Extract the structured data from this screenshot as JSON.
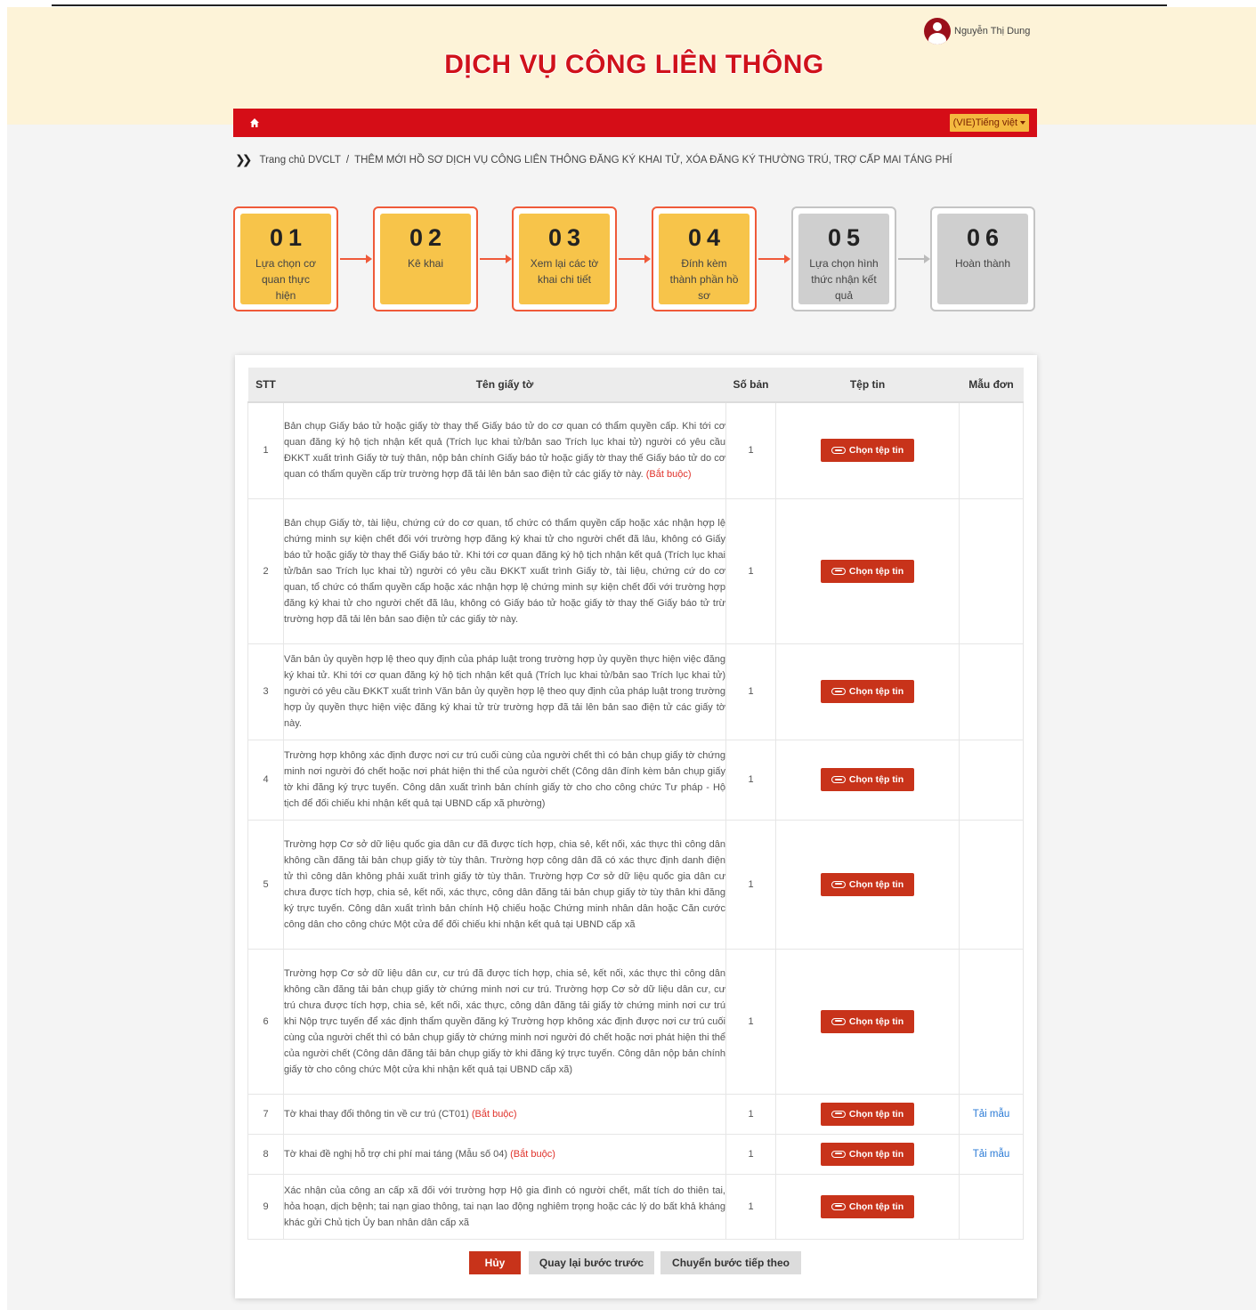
{
  "header": {
    "title": "DỊCH VỤ CÔNG LIÊN THÔNG",
    "user_name": "Nguyễn Thị Dung",
    "language": "(VIE)Tiếng việt"
  },
  "breadcrumb": {
    "home": "Trang chủ DVCLT",
    "separator": "/",
    "current": "THÊM MỚI HỒ SƠ DỊCH VỤ CÔNG LIÊN THÔNG ĐĂNG KÝ KHAI TỬ, XÓA ĐĂNG KÝ THƯỜNG TRÚ, TRỢ CẤP MAI TÁNG PHÍ"
  },
  "steps": [
    {
      "number": "01",
      "label": "Lựa chọn cơ quan thực hiện",
      "state": "done"
    },
    {
      "number": "02",
      "label": "Kê khai",
      "state": "done"
    },
    {
      "number": "03",
      "label": "Xem lại các tờ khai chi tiết",
      "state": "done"
    },
    {
      "number": "04",
      "label": "Đính kèm thành phần hồ sơ",
      "state": "current"
    },
    {
      "number": "05",
      "label": "Lựa chọn hình thức nhận kết quả",
      "state": "pending"
    },
    {
      "number": "06",
      "label": "Hoàn thành",
      "state": "pending"
    }
  ],
  "table": {
    "headers": {
      "stt": "STT",
      "name": "Tên giấy tờ",
      "qty": "Số bản",
      "file": "Tệp tin",
      "form": "Mẫu đơn"
    },
    "rows": [
      {
        "stt": "1",
        "name": "Bản chụp Giấy báo tử hoặc giấy tờ thay thế Giấy báo tử do cơ quan có thẩm quyền cấp. Khi tới cơ quan đăng ký hộ tịch nhận kết quả (Trích lục khai tử/bản sao Trích lục khai tử) người có yêu cầu ĐKKT xuất trình Giấy tờ tuỳ thân, nộp bản chính Giấy báo tử hoặc giấy tờ thay thế Giấy báo tử do cơ quan có thẩm quyền cấp trừ trường hợp đã tải lên bản sao điện tử các giấy tờ này.",
        "required": "(Bắt buộc)",
        "qty": "1",
        "button": "Chọn tệp tin",
        "form": ""
      },
      {
        "stt": "2",
        "name": "Bản chụp Giấy tờ, tài liệu, chứng cứ do cơ quan, tổ chức có thẩm quyền cấp hoặc xác nhận hợp lệ chứng minh sự kiện chết đối với trường hợp đăng ký khai tử cho người chết đã lâu, không có Giấy báo tử hoặc giấy tờ thay thế Giấy báo tử. Khi tới cơ quan đăng ký hộ tịch nhận kết quả (Trích lục khai tử/bản sao Trích lục khai tử) người có yêu cầu ĐKKT xuất trình Giấy tờ, tài liệu, chứng cứ do cơ quan, tổ chức có thẩm quyền cấp hoặc xác nhận hợp lệ chứng minh sự kiện chết đối với trường hợp đăng ký khai tử cho người chết đã lâu, không có Giấy báo tử hoặc giấy tờ thay thế Giấy báo tử trừ trường hợp đã tải lên bản sao điện tử các giấy tờ này.",
        "required": "",
        "qty": "1",
        "button": "Chọn tệp tin",
        "form": ""
      },
      {
        "stt": "3",
        "name": "Văn bản ủy quyền hợp lệ theo quy định của pháp luật trong trường hợp ủy quyền thực hiện việc đăng ký khai tử. Khi tới cơ quan đăng ký hộ tịch nhận kết quả (Trích lục khai tử/bản sao Trích lục khai tử) người có yêu cầu ĐKKT xuất trình Văn bản ủy quyền hợp lệ theo quy định của pháp luật trong trường hợp ủy quyền thực hiện việc đăng ký khai tử trừ trường hợp đã tải lên bản sao điện tử các giấy tờ này.",
        "required": "",
        "qty": "1",
        "button": "Chọn tệp tin",
        "form": ""
      },
      {
        "stt": "4",
        "name": "Trường hợp không xác định được nơi cư trú cuối cùng của người chết thì có bản chụp giấy tờ chứng minh nơi người đó chết hoặc nơi phát hiện thi thể của người chết (Công dân đính kèm bản chụp giấy tờ khi đăng ký trực tuyến. Công dân xuất trình bản chính giấy tờ cho cho công chức Tư pháp - Hộ tịch để đối chiếu khi nhận kết quả tại UBND cấp xã phường)",
        "required": "",
        "qty": "1",
        "button": "Chọn tệp tin",
        "form": ""
      },
      {
        "stt": "5",
        "name": "Trường hợp Cơ sở dữ liệu quốc gia dân cư đã được tích hợp, chia sẻ, kết nối, xác thực thì công dân không cần đăng tải bản chụp giấy tờ tùy thân. Trường hợp công dân đã có xác thực định danh điện tử thì công dân không phải xuất trình giấy tờ tùy thân. Trường hợp Cơ sở dữ liệu quốc gia dân cư chưa được tích hợp, chia sẻ, kết nối, xác thực, công dân đăng tải bản chụp giấy tờ tùy thân khi đăng ký trực tuyến. Công dân xuất trình bản chính Hộ chiếu hoặc Chứng minh nhân dân hoặc Căn cước công dân cho công chức Một cửa để đối chiếu khi nhận kết quả tại UBND cấp xã",
        "required": "",
        "qty": "1",
        "button": "Chọn tệp tin",
        "form": ""
      },
      {
        "stt": "6",
        "name": "Trường hợp Cơ sở dữ liệu dân cư, cư trú đã được tích hợp, chia sẻ, kết nối, xác thực thì công dân không cần đăng tải bản chụp giấy tờ chứng minh nơi cư trú. Trường hợp Cơ sở dữ liệu dân cư, cư trú chưa được tích hợp, chia sẻ, kết nối, xác thực, công dân đăng tải giấy tờ chứng minh nơi cư trú khi Nộp trực tuyến để xác định thẩm quyền đăng ký Trường hợp không xác định được nơi cư trú cuối cùng của người chết thì có bản chụp giấy tờ chứng minh nơi người đó chết hoặc nơi phát hiện thi thể của người chết (Công dân đăng tải bản chụp giấy tờ khi đăng ký trực tuyến. Công dân nộp bản chính giấy tờ cho công chức Một cửa khi nhận kết quả tại UBND cấp xã)",
        "required": "",
        "qty": "1",
        "button": "Chọn tệp tin",
        "form": ""
      },
      {
        "stt": "7",
        "name": "Tờ khai thay đổi thông tin về cư trú (CT01)",
        "required": "(Bắt buộc)",
        "qty": "1",
        "button": "Chọn tệp tin",
        "form": "Tải mẫu"
      },
      {
        "stt": "8",
        "name": "Tờ khai đề nghị hỗ trợ chi phí mai táng (Mẫu số 04)",
        "required": "(Bắt buộc)",
        "qty": "1",
        "button": "Chọn tệp tin",
        "form": "Tải mẫu"
      },
      {
        "stt": "9",
        "name": "Xác nhận của công an cấp xã đối với trường hợp Hộ gia đình có người chết, mất tích do thiên tai, hỏa hoạn, dịch bệnh; tai nạn giao thông, tai nạn lao động nghiêm trọng hoặc các lý do bất khả kháng khác gửi Chủ tịch Ủy ban nhân dân cấp xã",
        "required": "",
        "qty": "1",
        "button": "Chọn tệp tin",
        "form": ""
      }
    ]
  },
  "actions": {
    "cancel": "Hủy",
    "back": "Quay lại bước trước",
    "next": "Chuyển bước tiếp theo"
  },
  "colors": {
    "brand_red": "#d50d17",
    "step_active_fill": "#f7c44a",
    "step_inactive_fill": "#cfcfcf",
    "button_red": "#c8331a",
    "link_blue": "#2b7bd6"
  },
  "icons": [
    "home-icon",
    "user-avatar-icon",
    "double-chevron-icon",
    "paperclip-icon",
    "caret-down-icon"
  ]
}
